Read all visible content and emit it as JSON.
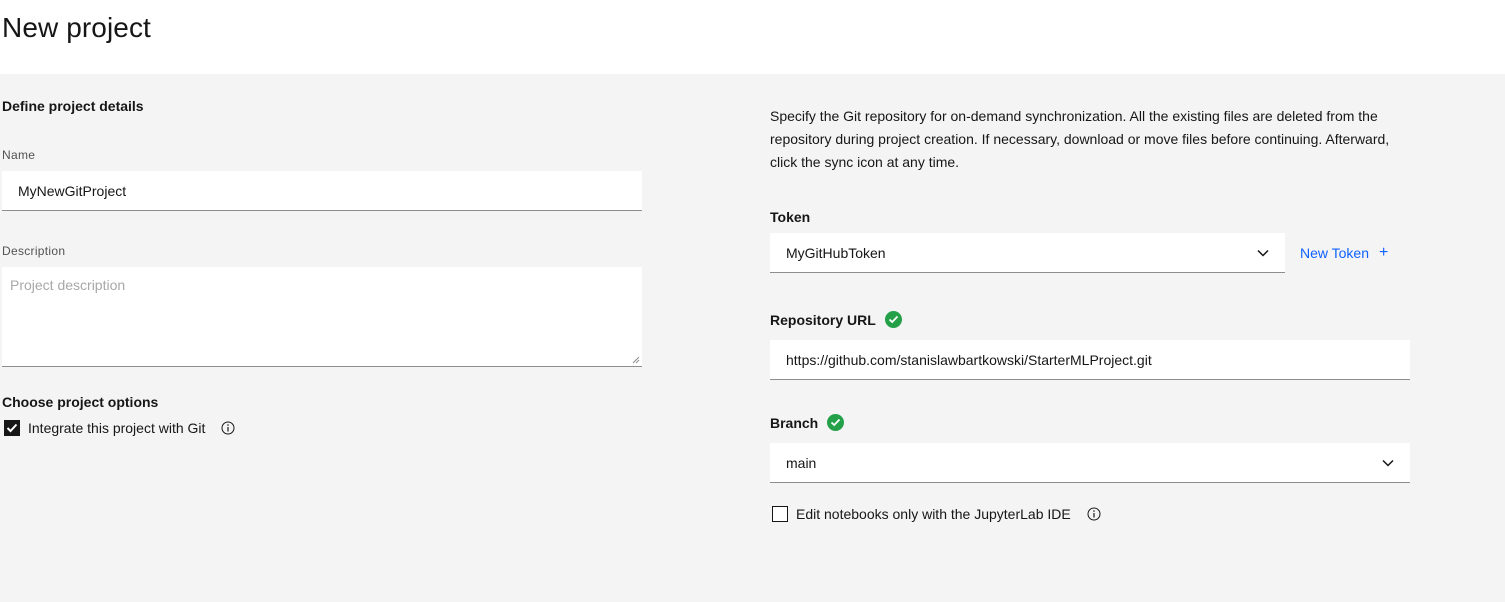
{
  "header": {
    "title": "New project"
  },
  "details": {
    "heading": "Define project details",
    "name_label": "Name",
    "name_value": "MyNewGitProject",
    "description_label": "Description",
    "description_placeholder": "Project description"
  },
  "options": {
    "heading": "Choose project options",
    "git_label": "Integrate this project with Git",
    "git_checked": true
  },
  "git": {
    "description": "Specify the Git repository for on-demand synchronization. All the existing files are deleted from the repository during project creation. If necessary, download or move files before continuing. Afterward, click the sync icon at any time.",
    "token_label": "Token",
    "token_value": "MyGitHubToken",
    "new_token_label": "New Token",
    "new_token_icon": "+",
    "repo_label": "Repository URL",
    "repo_value": "https://github.com/stanislawbartkowski/StarterMLProject.git",
    "branch_label": "Branch",
    "branch_value": "main",
    "jupyter_label": "Edit notebooks only with the JupyterLab IDE",
    "jupyter_checked": false
  },
  "colors": {
    "accent": "#0f62fe",
    "success": "#24a148",
    "field_bg": "#ffffff",
    "page_bg": "#f4f4f4"
  }
}
